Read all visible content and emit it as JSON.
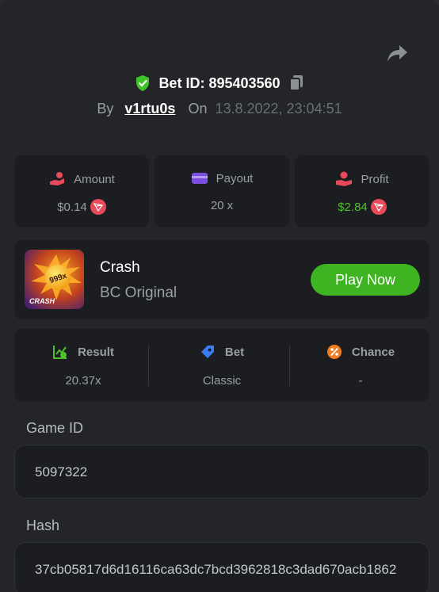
{
  "header": {
    "bet_id_label": "Bet ID: 895403560",
    "by_label": "By",
    "username": "v1rtu0s",
    "on_label": "On",
    "datetime": "13.8.2022, 23:04:51"
  },
  "stats": [
    {
      "label": "Amount",
      "value": "$0.14",
      "icon": "bet-hand-icon",
      "currency_icon": "trx-icon"
    },
    {
      "label": "Payout",
      "value": "20 x",
      "icon": "wallet-card-icon"
    },
    {
      "label": "Profit",
      "value": "$2.84",
      "icon": "profit-hand-icon",
      "currency_icon": "trx-icon"
    }
  ],
  "game": {
    "name": "Crash",
    "provider": "BC Original",
    "play_label": "Play Now",
    "thumb_multiplier": "999x",
    "thumb_title": "CRASH"
  },
  "result": [
    {
      "label": "Result",
      "value": "20.37x",
      "icon": "result-chart-icon"
    },
    {
      "label": "Bet",
      "value": "Classic",
      "icon": "bet-tag-icon"
    },
    {
      "label": "Chance",
      "value": "-",
      "icon": "percent-icon"
    }
  ],
  "fields": {
    "game_id_label": "Game ID",
    "game_id_value": "5097322",
    "hash_label": "Hash",
    "hash_value": "37cb05817d6d16116ca63dc7bcd3962818c3dad670acb1862"
  },
  "colors": {
    "accent_green": "#3fb422",
    "profit_green": "#4fc02b",
    "shield_green": "#3fc429",
    "amount_pink": "#e8495b",
    "payout_purple": "#7a4fe0",
    "bet_blue": "#3b7cf0",
    "chance_orange": "#f07d22"
  }
}
